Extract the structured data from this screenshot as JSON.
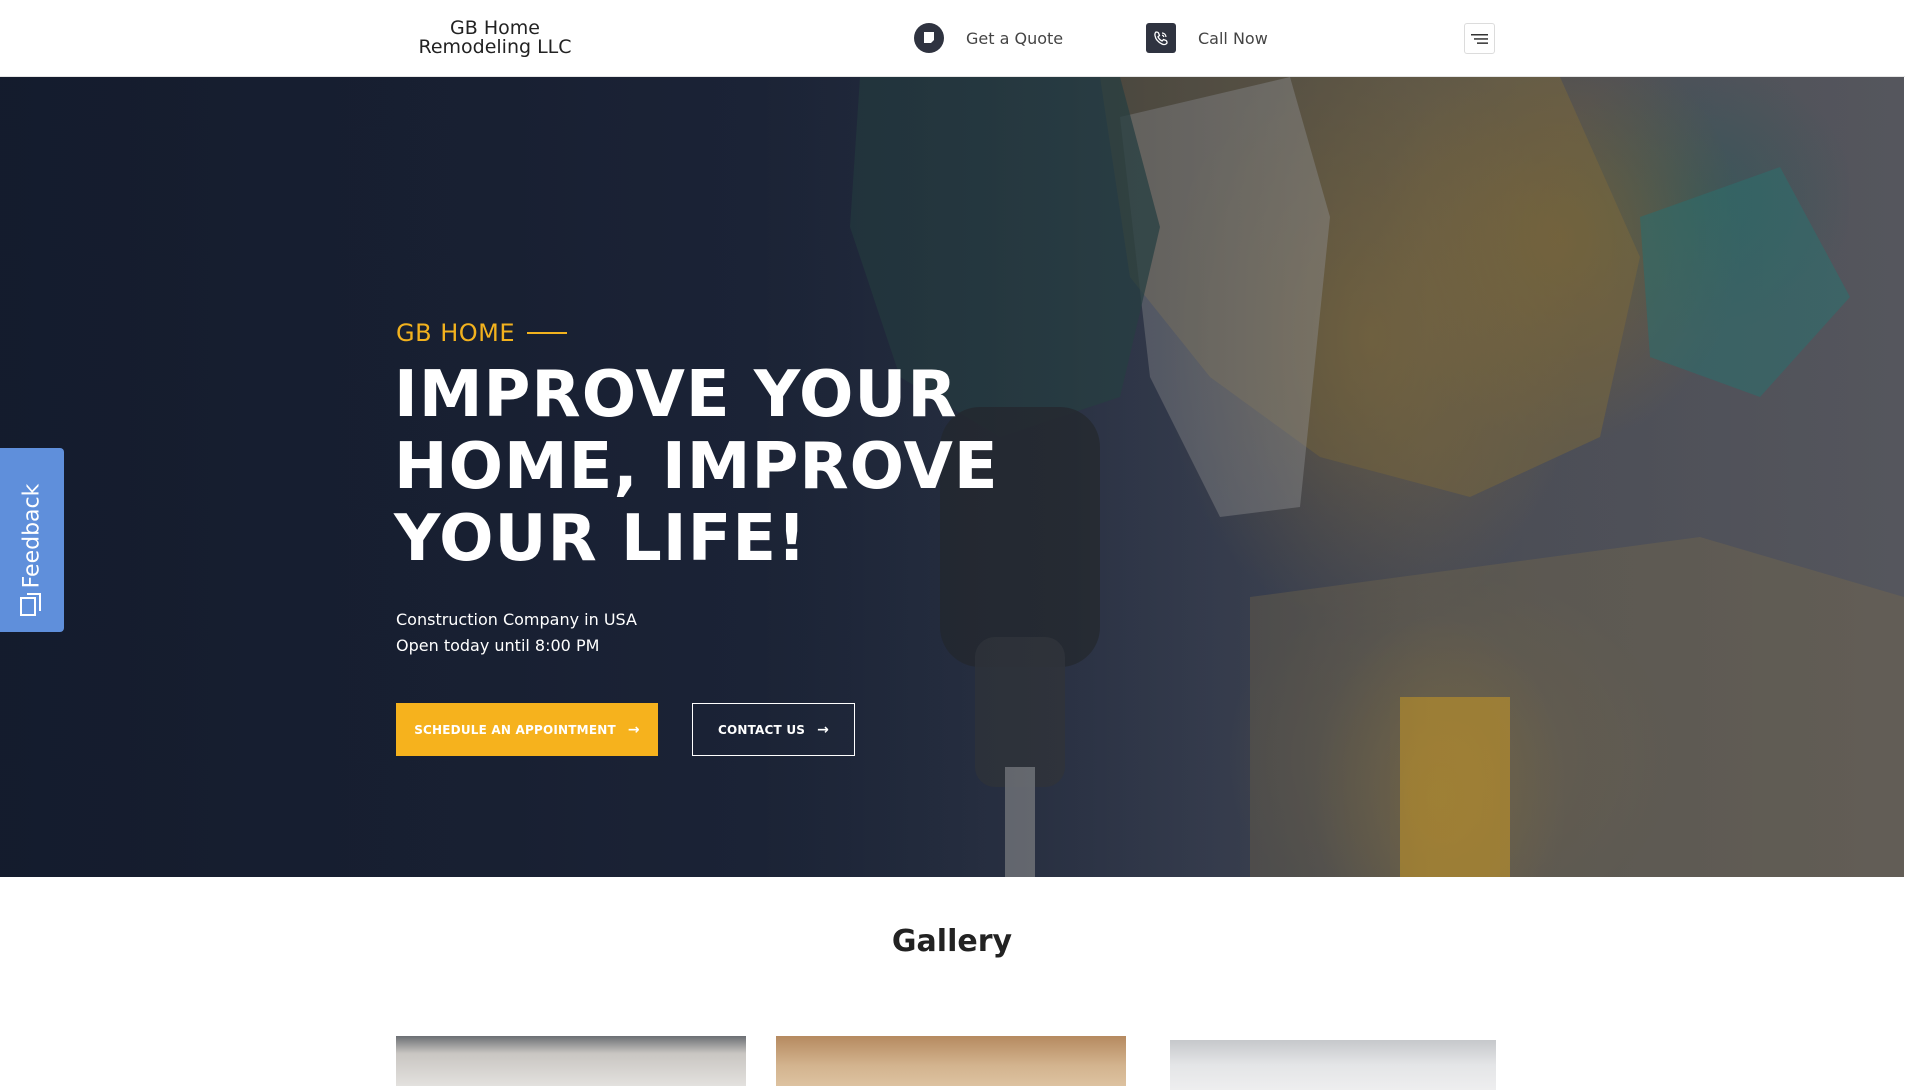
{
  "header": {
    "logo_line1": "GB Home",
    "logo_line2": "Remodeling LLC",
    "quote_label": "Get a Quote",
    "call_label": "Call Now",
    "quote_icon": "quote-icon",
    "call_icon": "phone-icon",
    "menu_icon": "hamburger-icon"
  },
  "hero": {
    "eyebrow": "GB HOME",
    "headline_line1": "IMPROVE YOUR",
    "headline_line2": "HOME, IMPROVE",
    "headline_line3": "YOUR LIFE!",
    "sub_line1": "Construction Company in USA",
    "sub_line2": "Open today until 8:00 PM",
    "primary_button": "SCHEDULE AN APPOINTMENT",
    "secondary_button": "CONTACT US"
  },
  "feedback": {
    "label": "Feedback"
  },
  "gallery": {
    "title": "Gallery"
  },
  "colors": {
    "accent": "#f6b21d",
    "feedback_tab": "#5f8fdb",
    "hero_overlay": "#1a2233"
  }
}
